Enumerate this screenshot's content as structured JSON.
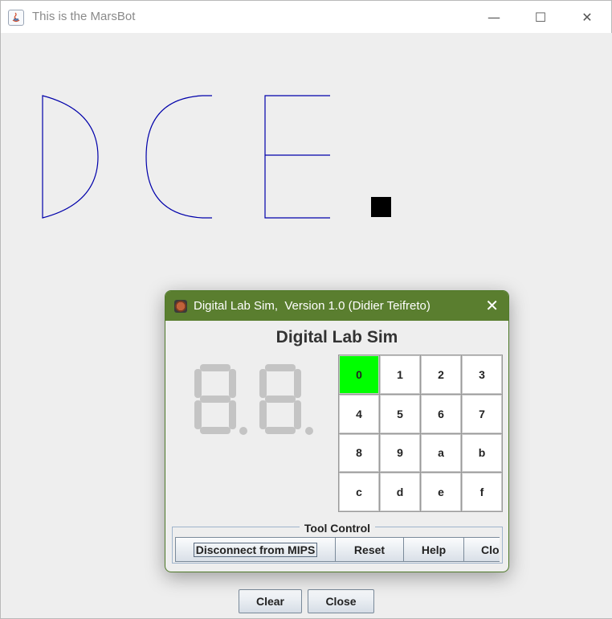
{
  "window": {
    "title": "This is the MarsBot",
    "minimize_glyph": "—",
    "maximize_glyph": "☐",
    "close_glyph": "✕"
  },
  "canvas": {
    "drawn_letters": [
      "D",
      "C",
      "E",
      "."
    ],
    "stroke_color": "#0000aa",
    "dot_color": "#000000"
  },
  "bottom_buttons": {
    "clear_label": "Clear",
    "close_label": "Close"
  },
  "dialog": {
    "title": "Digital Lab Sim,  Version 1.0 (Didier Teifreto)",
    "close_glyph": "✕",
    "heading": "Digital Lab Sim",
    "seven_segment_display": "8.8.",
    "keypad": {
      "keys": [
        "0",
        "1",
        "2",
        "3",
        "4",
        "5",
        "6",
        "7",
        "8",
        "9",
        "a",
        "b",
        "c",
        "d",
        "e",
        "f"
      ],
      "active_key": "0",
      "active_color": "#00ff00"
    },
    "tool_control": {
      "legend": "Tool Control",
      "disconnect_label": "Disconnect from MIPS",
      "reset_label": "Reset",
      "help_label": "Help",
      "close_label": "Clos"
    },
    "accent_color": "#5a7e2f"
  }
}
